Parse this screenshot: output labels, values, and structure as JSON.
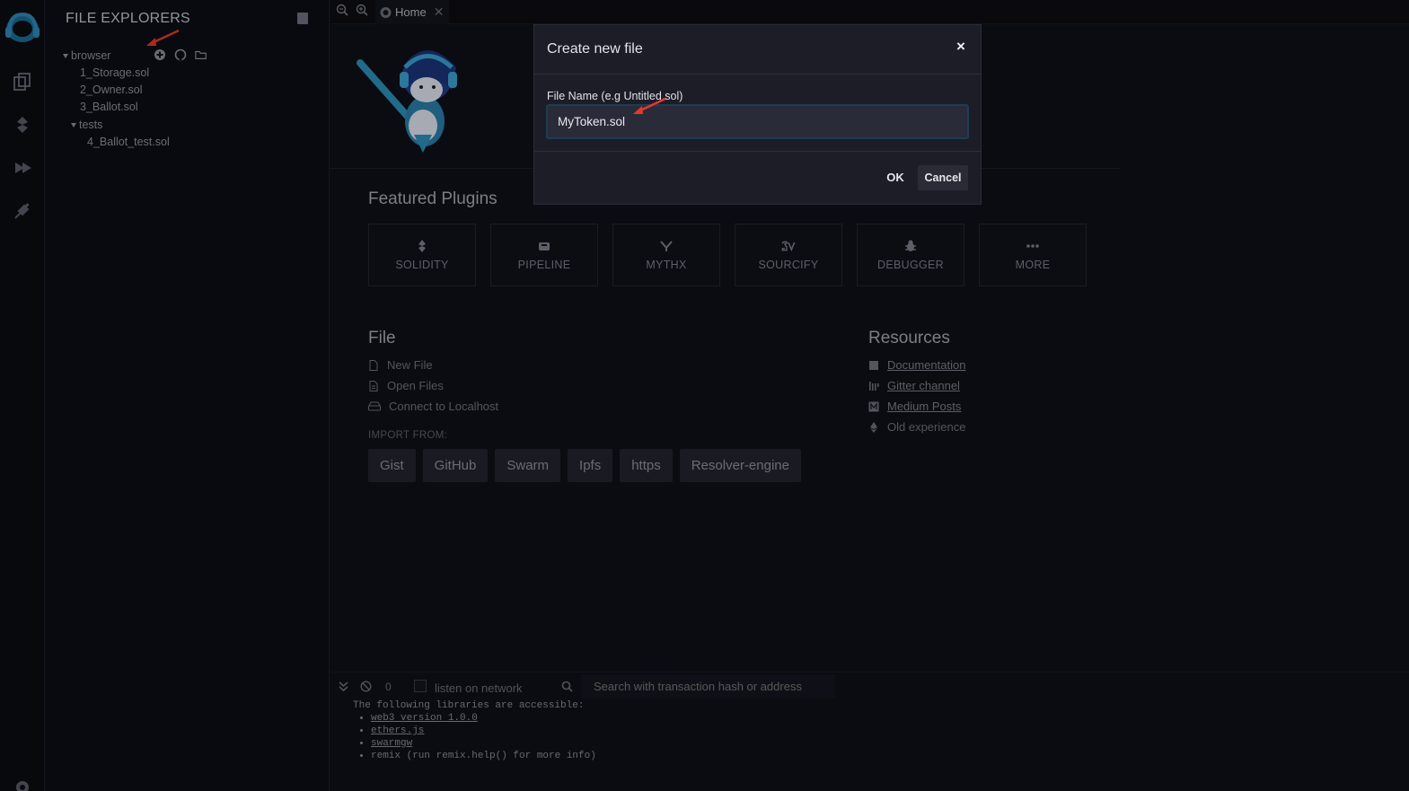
{
  "sidebar": {
    "title": "FILE EXPLORERS",
    "root_folder": "browser",
    "files": [
      "1_Storage.sol",
      "2_Owner.sol",
      "3_Ballot.sol"
    ],
    "subfolder": "tests",
    "subfolder_files": [
      "4_Ballot_test.sol"
    ]
  },
  "tabs": {
    "home_label": "Home",
    "close_glyph": "✕"
  },
  "featured": {
    "title": "Featured Plugins",
    "plugins": [
      "SOLIDITY",
      "PIPELINE",
      "MYTHX",
      "SOURCIFY",
      "DEBUGGER",
      "MORE"
    ]
  },
  "file_section": {
    "title": "File",
    "links": [
      "New File",
      "Open Files",
      "Connect to Localhost"
    ],
    "import_label": "IMPORT FROM:",
    "import_buttons": [
      "Gist",
      "GitHub",
      "Swarm",
      "Ipfs",
      "https",
      "Resolver-engine"
    ]
  },
  "resources": {
    "title": "Resources",
    "links": [
      "Documentation",
      "Gitter channel",
      "Medium Posts",
      "Old experience"
    ]
  },
  "terminal": {
    "count": "0",
    "listen_label": "listen on network",
    "search_placeholder": "Search with transaction hash or address",
    "intro": "The following libraries are accessible:",
    "libs": [
      "web3 version 1.0.0",
      "ethers.js",
      "swarmgw",
      "remix (run remix.help() for more info)"
    ]
  },
  "modal": {
    "title": "Create new file",
    "close_glyph": "×",
    "field_label": "File Name (e.g Untitled.sol)",
    "field_value": "MyToken.sol",
    "ok_label": "OK",
    "cancel_label": "Cancel"
  },
  "colors": {
    "accent": "#1d3c55",
    "annotation_arrow": "#e5392b",
    "modal_bg": "#1c1d27"
  }
}
